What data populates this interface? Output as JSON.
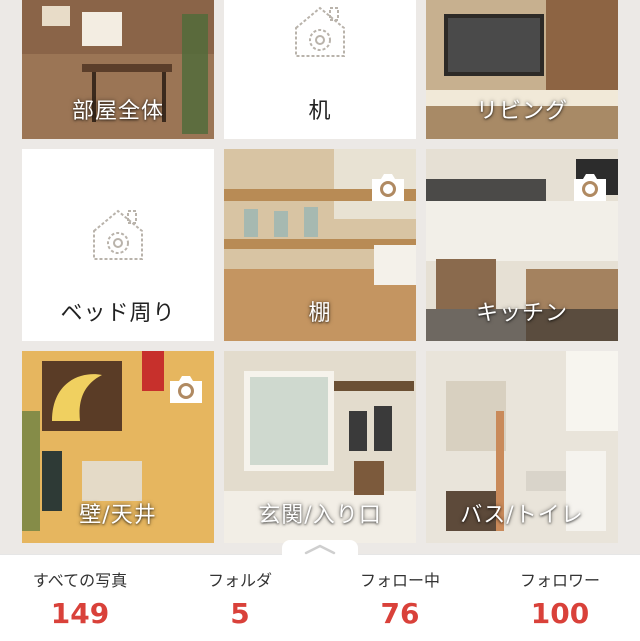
{
  "folders": [
    {
      "label": "部屋全体",
      "has_photo": true,
      "camera_badge": false
    },
    {
      "label": "机",
      "has_photo": false,
      "camera_badge": false
    },
    {
      "label": "リビング",
      "has_photo": true,
      "camera_badge": false
    },
    {
      "label": "ベッド周り",
      "has_photo": false,
      "camera_badge": false
    },
    {
      "label": "棚",
      "has_photo": true,
      "camera_badge": true
    },
    {
      "label": "キッチン",
      "has_photo": true,
      "camera_badge": true
    },
    {
      "label": "壁/天井",
      "has_photo": true,
      "camera_badge": true
    },
    {
      "label": "玄関/入り口",
      "has_photo": true,
      "camera_badge": false
    },
    {
      "label": "バス/トイレ",
      "has_photo": true,
      "camera_badge": false
    }
  ],
  "stats": [
    {
      "label": "すべての写真",
      "value": "149"
    },
    {
      "label": "フォルダ",
      "value": "5"
    },
    {
      "label": "フォロー中",
      "value": "76"
    },
    {
      "label": "フォロワー",
      "value": "100"
    }
  ],
  "colors": {
    "accent": "#d9413a",
    "background": "#ece9e6",
    "placeholder_icon": "#b9b3ab"
  },
  "icons": {
    "empty_folder": "camera-house-placeholder-icon",
    "camera_badge": "camera-icon",
    "handle": "chevron-up-icon"
  }
}
